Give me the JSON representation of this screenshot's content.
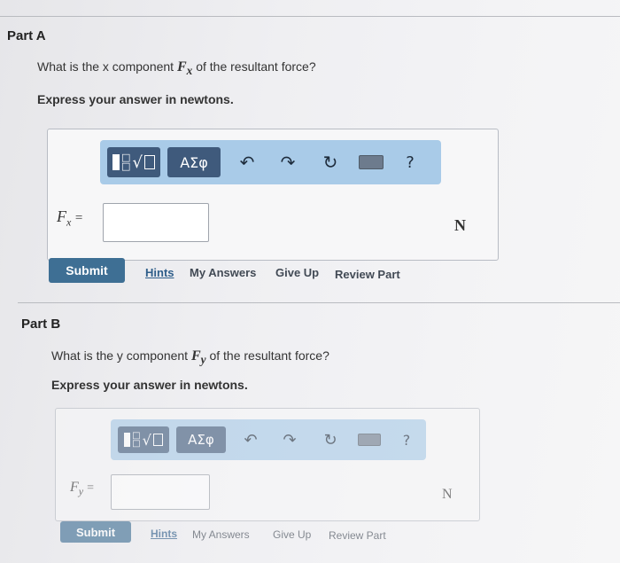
{
  "part_a": {
    "title": "Part A",
    "question_prefix": "What is the x component ",
    "symbol": "F",
    "subscript": "x",
    "question_suffix": " of the resultant force?",
    "instruction": "Express your answer in newtons.",
    "eq_sign": "=",
    "input_value": "",
    "unit": "N",
    "toolbar": {
      "templates_icon": "fraction-sqrt-templates-icon",
      "symbols_label": "ΑΣφ",
      "undo_icon": "undo-arrow-icon",
      "redo_icon": "redo-arrow-icon",
      "reset_icon": "reset-circle-icon",
      "keyboard_icon": "keyboard-icon",
      "help_label": "?"
    },
    "submit_label": "Submit",
    "links": [
      "Hints",
      "My Answers",
      "Give Up",
      "Review Part"
    ]
  },
  "part_b": {
    "title": "Part B",
    "question_prefix": "What is the y component ",
    "symbol": "F",
    "subscript": "y",
    "question_suffix": " of the resultant force?",
    "instruction": "Express your answer in newtons.",
    "eq_sign": "=",
    "input_value": "",
    "unit": "N",
    "toolbar": {
      "symbols_label": "ΑΣφ",
      "help_label": "?"
    },
    "submit_label": "Submit",
    "links": [
      "Hints",
      "My Answers",
      "Give Up",
      "Review Part"
    ]
  },
  "colors": {
    "toolbar_bg": "#a9cbe8",
    "toolbar_button": "#3f5a7c",
    "submit_bg": "#3e6f94",
    "hints_link": "#2f5e8a"
  }
}
